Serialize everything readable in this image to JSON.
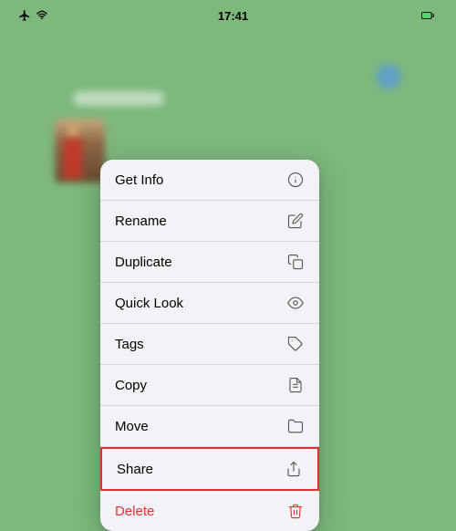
{
  "statusBar": {
    "time": "17:41",
    "icons": {
      "airplane": "✈",
      "wifi": "wifi-icon",
      "battery": "battery-icon"
    }
  },
  "contextMenu": {
    "items": [
      {
        "id": "get-info",
        "label": "Get Info",
        "icon": "info-circle-icon",
        "special": false,
        "delete": false
      },
      {
        "id": "rename",
        "label": "Rename",
        "icon": "pencil-icon",
        "special": false,
        "delete": false
      },
      {
        "id": "duplicate",
        "label": "Duplicate",
        "icon": "duplicate-icon",
        "special": false,
        "delete": false
      },
      {
        "id": "quick-look",
        "label": "Quick Look",
        "icon": "eye-icon",
        "special": false,
        "delete": false
      },
      {
        "id": "tags",
        "label": "Tags",
        "icon": "tag-icon",
        "special": false,
        "delete": false
      },
      {
        "id": "copy",
        "label": "Copy",
        "icon": "copy-icon",
        "special": false,
        "delete": false
      },
      {
        "id": "move",
        "label": "Move",
        "icon": "folder-icon",
        "special": false,
        "delete": false
      },
      {
        "id": "share",
        "label": "Share",
        "icon": "share-icon",
        "special": true,
        "delete": false
      },
      {
        "id": "delete",
        "label": "Delete",
        "icon": "trash-icon",
        "special": false,
        "delete": true
      }
    ]
  }
}
